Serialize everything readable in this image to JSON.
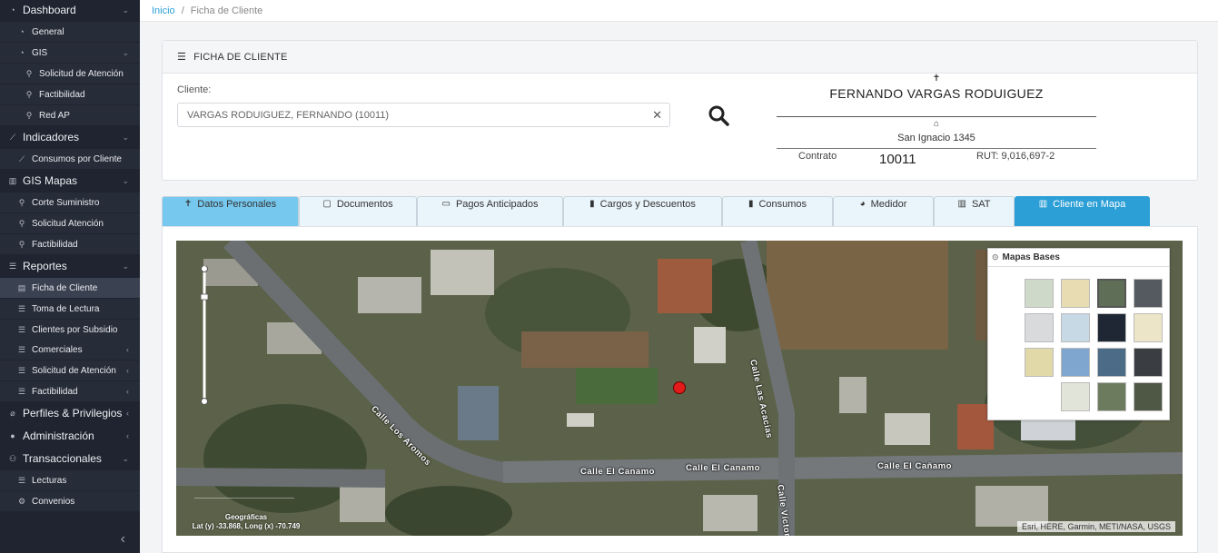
{
  "sidebar": {
    "dashboard": "Dashboard",
    "general": "General",
    "gis": "GIS",
    "solicitud_atencion_1": "Solicitud de Atención",
    "factibilidad_1": "Factibilidad",
    "red_ap": "Red AP",
    "indicadores": "Indicadores",
    "consumos_cliente": "Consumos por Cliente",
    "gis_mapas": "GIS Mapas",
    "corte_suministro": "Corte Suministro",
    "solicitud_atencion_2": "Solicitud Atención",
    "factibilidad_2": "Factibilidad",
    "reportes": "Reportes",
    "ficha_cliente": "Ficha de Cliente",
    "toma_lectura": "Toma de Lectura",
    "clientes_subsidio": "Clientes por Subsidio",
    "comerciales": "Comerciales",
    "solicitud_atencion_3": "Solicitud de Atención",
    "factibilidad_3": "Factibilidad",
    "perfiles": "Perfiles & Privilegios",
    "administracion": "Administración",
    "transaccionales": "Transaccionales",
    "lecturas": "Lecturas",
    "convenios": "Convenios"
  },
  "breadcrumb": {
    "home": "Inicio",
    "separator": "/",
    "current": "Ficha de Cliente"
  },
  "panel": {
    "title": "FICHA DE CLIENTE",
    "client_label": "Cliente:",
    "client_value": "VARGAS RODUIGUEZ, FERNANDO (10011)",
    "client_name": "FERNANDO VARGAS RODUIGUEZ",
    "address": "San Ignacio 1345",
    "contrato_label": "Contrato",
    "contrato_value": "10011",
    "rut": "RUT: 9,016,697-2"
  },
  "tabs": [
    {
      "label": "Datos Personales",
      "icon": "person-icon"
    },
    {
      "label": "Documentos",
      "icon": "document-icon"
    },
    {
      "label": "Pagos Anticipados",
      "icon": "credit-card-icon"
    },
    {
      "label": "Cargos y Descuentos",
      "icon": "bar-chart-icon"
    },
    {
      "label": "Consumos",
      "icon": "bar-chart-icon"
    },
    {
      "label": "Medidor",
      "icon": "gauge-icon"
    },
    {
      "label": "SAT",
      "icon": "map-icon"
    },
    {
      "label": "Cliente en Mapa",
      "icon": "map-icon"
    }
  ],
  "map": {
    "streets": {
      "acacias": "Calle Las Acacias",
      "aromos": "Calle Los Aromos",
      "canamo_1": "Calle El Canamo",
      "canamo_2": "Calle El Canamo",
      "canamo_3": "Calle El Cañamo",
      "victor": "Calle Víctor"
    },
    "coords_title": "Geográficas",
    "coords_value": "Lat (y) -33.868, Long (x) -70.749",
    "attribution": "Esri, HERE, Garmin, METI/NASA, USGS",
    "basemap_title": "Mapas Bases"
  },
  "colors": {
    "accent": "#2c9fd6",
    "sidebar_bg": "#1f2430",
    "marker": "#e31b1b"
  }
}
